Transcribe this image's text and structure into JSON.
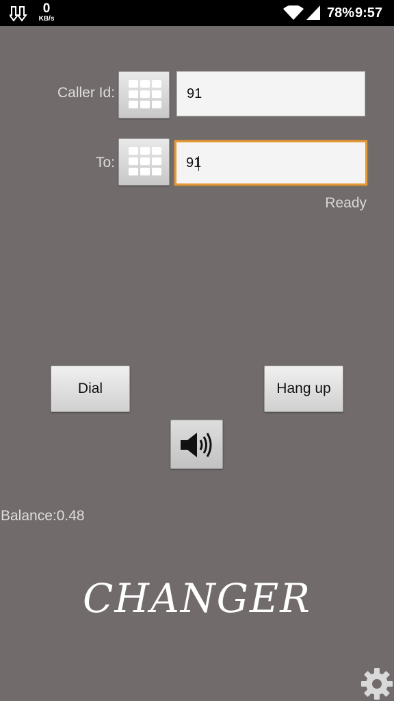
{
  "status_bar": {
    "net_speed_value": "0",
    "net_speed_unit": "KB/s",
    "battery": "78%",
    "time": "9:57"
  },
  "form": {
    "caller_id_label": "Caller Id:",
    "caller_id_value": "91",
    "to_label": "To:",
    "to_value": "91",
    "status": "Ready"
  },
  "actions": {
    "dial_label": "Dial",
    "hangup_label": "Hang up",
    "speaker_icon": "speaker-icon"
  },
  "balance_text": "Balance:0.48",
  "logo_text": "CHANGER",
  "icons": {
    "settings": "gear-icon",
    "keypad": "keypad-grid-icon"
  },
  "colors": {
    "background": "#716b6b",
    "focus_border": "#e79a34"
  }
}
